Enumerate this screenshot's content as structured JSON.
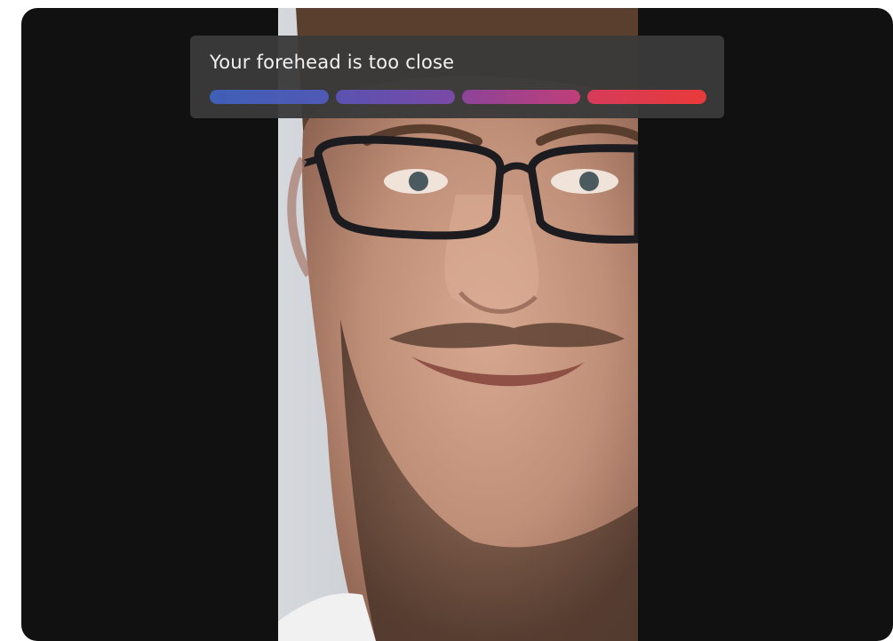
{
  "feedback": {
    "message": "Your forehead is too close"
  },
  "progress": {
    "segments": [
      {
        "name": "segment-1",
        "color_start": "#3f5fb6",
        "color_end": "#5059b5"
      },
      {
        "name": "segment-2",
        "color_start": "#5a52b0",
        "color_end": "#7a4aa6"
      },
      {
        "name": "segment-3",
        "color_start": "#8c4499",
        "color_end": "#c03e78"
      },
      {
        "name": "segment-4",
        "color_start": "#d63b5a",
        "color_end": "#e83a3a"
      }
    ]
  },
  "colors": {
    "frame_background": "#111111",
    "panel_background": "#3a3a3a",
    "text": "#f2f2f2"
  },
  "camera": {
    "subject": "face"
  }
}
